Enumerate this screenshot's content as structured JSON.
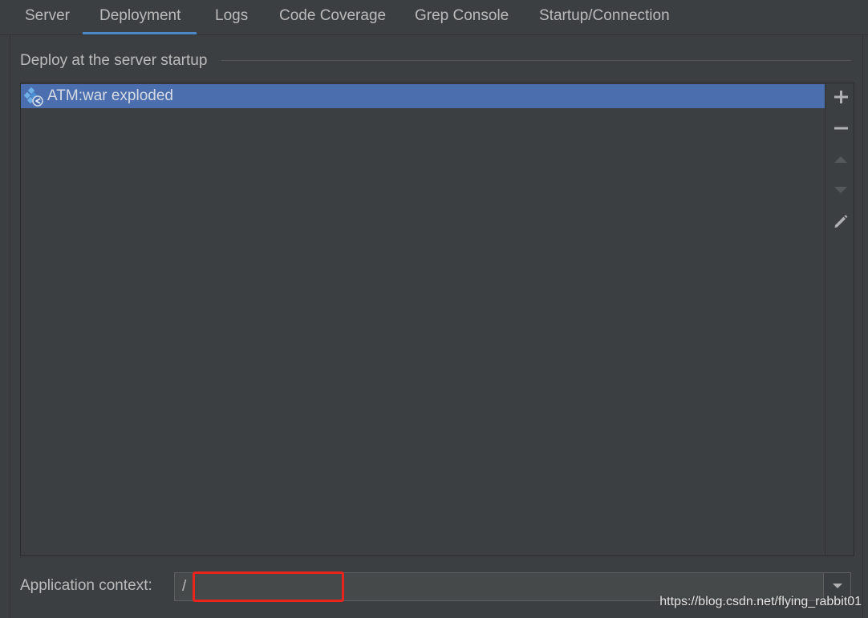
{
  "tabs": [
    {
      "label": "Server",
      "active": false
    },
    {
      "label": "Deployment",
      "active": true
    },
    {
      "label": "Logs",
      "active": false
    },
    {
      "label": "Code Coverage",
      "active": false
    },
    {
      "label": "Grep Console",
      "active": false
    },
    {
      "label": "Startup/Connection",
      "active": false
    }
  ],
  "deploy_section": {
    "title": "Deploy at the server startup",
    "items": [
      {
        "label": "ATM:war exploded",
        "icon": "war-exploded-artifact-icon",
        "selected": true
      }
    ],
    "toolbar": [
      {
        "name": "add-icon",
        "enabled": true
      },
      {
        "name": "remove-icon",
        "enabled": true
      },
      {
        "name": "move-up-icon",
        "enabled": false
      },
      {
        "name": "move-down-icon",
        "enabled": false
      },
      {
        "name": "edit-icon",
        "enabled": true
      }
    ]
  },
  "application_context": {
    "label": "Application context:",
    "value": "/"
  },
  "watermark": "https://blog.csdn.net/flying_rabbit01",
  "colors": {
    "background": "#3c3f41",
    "selection": "#4b6eaf",
    "tab_accent": "#4a88c7",
    "highlight": "#e8241c"
  }
}
